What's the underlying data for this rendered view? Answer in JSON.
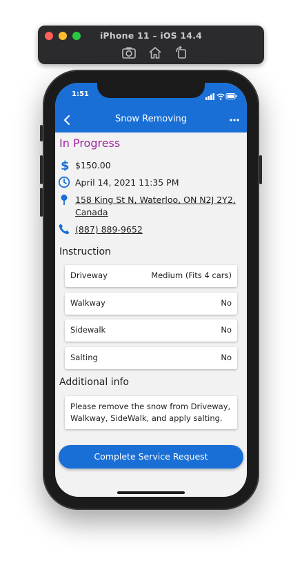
{
  "simulator": {
    "title": "iPhone 11 – iOS 14.4",
    "tools": [
      "screenshot-icon",
      "home-icon",
      "rotate-icon"
    ]
  },
  "statusbar": {
    "time": "1:51"
  },
  "navbar": {
    "title": "Snow Removing",
    "back_icon": "chevron-left-icon",
    "more_icon": "more-dots-icon"
  },
  "request": {
    "status": "In Progress",
    "price": "$150.00",
    "datetime": "April 14, 2021 11:35 PM",
    "address": "158 King St N, Waterloo, ON N2J 2Y2, Canada",
    "phone": "(887) 889-9652"
  },
  "instruction": {
    "title": "Instruction",
    "items": [
      {
        "label": "Driveway",
        "value": "Medium (Fits 4 cars)"
      },
      {
        "label": "Walkway",
        "value": "No"
      },
      {
        "label": "Sidewalk",
        "value": "No"
      },
      {
        "label": "Salting",
        "value": "No"
      }
    ]
  },
  "additional_info": {
    "title": "Additional info",
    "text": "Please remove the snow from Driveway, Walkway, SideWalk, and apply salting."
  },
  "actions": {
    "complete_label": "Complete Service Request"
  },
  "colors": {
    "brand": "#1a6fd6",
    "status": "#a0209e"
  }
}
